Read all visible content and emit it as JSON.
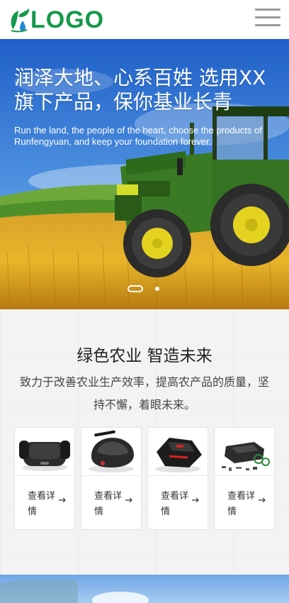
{
  "header": {
    "logo_text": "LOGO",
    "logo_icon": "leaf-drop-icon",
    "menu_icon": "hamburger-menu-icon"
  },
  "banner": {
    "title_line1": "润泽大地、心系百姓 选用XX",
    "title_line2": "旗下产品，保你基业长青",
    "subtitle": "Run the land, the people of the heart, choose the products of Runfengyuan, and keep your foundation forever.",
    "slides": 2,
    "active_slide": 1
  },
  "section": {
    "title": "绿色农业 智造未来",
    "description": "致力于改善农业生产效率，提高农产品的质量，坚持不懈，着眼未来。",
    "products": [
      {
        "more_label": "查看详情",
        "image": "robot-mower-front-image"
      },
      {
        "more_label": "查看详情",
        "image": "robot-mower-angle-image"
      },
      {
        "more_label": "查看详情",
        "image": "robot-mower-red-image"
      },
      {
        "more_label": "查看详情",
        "image": "robot-mower-kit-image"
      }
    ]
  },
  "colors": {
    "brand_green": "#14984a",
    "menu_gray": "#999999",
    "sky_blue": "#2f6fd0",
    "wheat_gold": "#e0a51e"
  }
}
